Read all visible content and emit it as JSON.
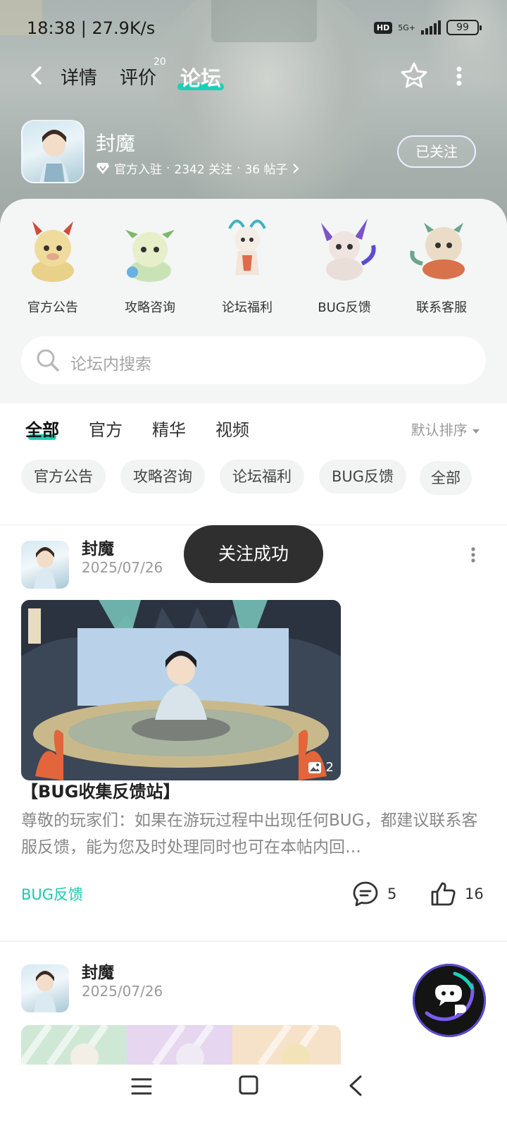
{
  "status_bar": {
    "time": "18:38 | 27.9K/s",
    "hd": "HD",
    "network": "5G+",
    "battery": "99"
  },
  "top_nav": {
    "tabs": [
      {
        "label": "详情"
      },
      {
        "label": "评价",
        "badge": "20"
      },
      {
        "label": "论坛",
        "active": true
      }
    ]
  },
  "game": {
    "name": "封魔",
    "meta": {
      "official": "官方入驻",
      "followers": "2342 关注",
      "posts": "36 帖子",
      "sep": "·"
    },
    "follow_button": "已关注"
  },
  "categories": [
    {
      "label": "官方公告",
      "icon": "yellow-dragon-mascot"
    },
    {
      "label": "攻略咨询",
      "icon": "green-dragon-mascot"
    },
    {
      "label": "论坛福利",
      "icon": "white-dragon-mascot"
    },
    {
      "label": "BUG反馈",
      "icon": "purple-dragon-mascot"
    },
    {
      "label": "联系客服",
      "icon": "lion-mascot"
    }
  ],
  "search": {
    "placeholder": "论坛内搜索"
  },
  "filter_tabs": [
    {
      "label": "全部",
      "active": true
    },
    {
      "label": "官方"
    },
    {
      "label": "精华"
    },
    {
      "label": "视频"
    }
  ],
  "sort": {
    "label": "默认排序"
  },
  "chips": [
    "官方公告",
    "攻略咨询",
    "论坛福利",
    "BUG反馈",
    "全部"
  ],
  "toast": "关注成功",
  "posts": [
    {
      "author": "封魔",
      "date": "2025/07/26",
      "image_count": "2",
      "title": "【BUG收集反馈站】",
      "body": "尊敬的玩家们：如果在游玩过程中出现任何BUG，都建议联系客服反馈，能为您及时处理同时也可在本帖内回…",
      "tag": "BUG反馈",
      "comments": "5",
      "likes": "16"
    },
    {
      "author": "封魔",
      "date": "2025/07/26"
    }
  ],
  "colors": {
    "accent": "#1bd1b4",
    "tag": "#1bc9ae",
    "toast_bg": "#2f2f2f"
  }
}
